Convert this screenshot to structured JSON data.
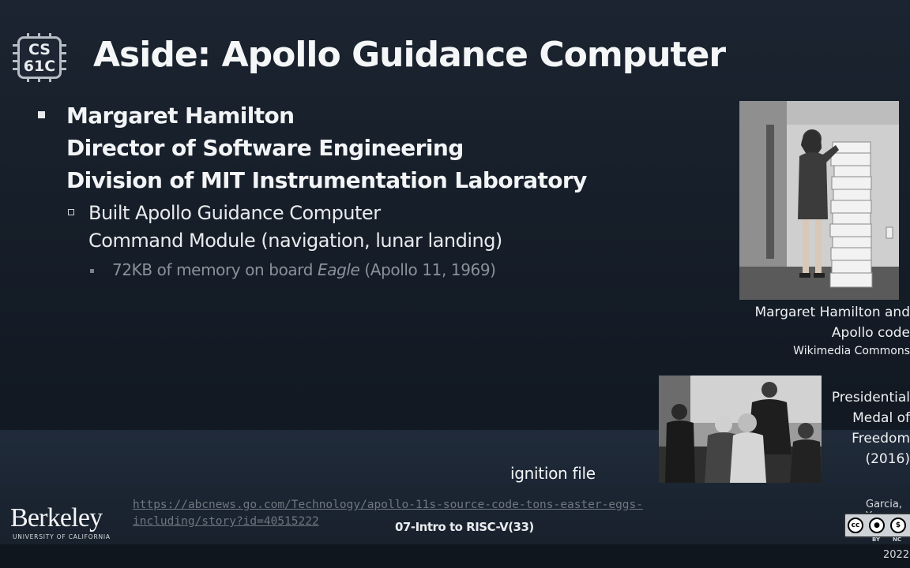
{
  "logo": {
    "line1": "CS",
    "line2": "61C"
  },
  "title": "Aside: Apollo Guidance Computer",
  "level1": [
    "Margaret Hamilton",
    "Director of Software Engineering",
    "Division of MIT Instrumentation Laboratory"
  ],
  "level2": [
    "Built Apollo Guidance Computer",
    "Command Module (navigation, lunar landing)"
  ],
  "level3": {
    "prefix": "72KB of memory on board ",
    "italic": "Eagle",
    "suffix": " (Apollo 11, 1969)"
  },
  "photo1_caption": {
    "line1": "Margaret Hamilton and",
    "line2": "Apollo code",
    "source": "Wikimedia Commons"
  },
  "photo2_caption": {
    "line1": "Presidential",
    "line2": "Medal of",
    "line3": "Freedom",
    "line4": "(2016)"
  },
  "ignition_text": "ignition file",
  "link": {
    "line1": "https://abcnews.go.com/Technology/apollo-11s-source-code-tons-easter-eggs-",
    "line2": "including/story?id=40515222"
  },
  "footer": {
    "institution": "Berkeley",
    "institution_sub": "UNIVERSITY OF CALIFORNIA",
    "lecture": "07-Intro to RISC-V",
    "page": "(33)",
    "author": "Garcia, Y",
    "cc_labels": [
      "BY",
      "NC"
    ],
    "year": "2022-"
  }
}
